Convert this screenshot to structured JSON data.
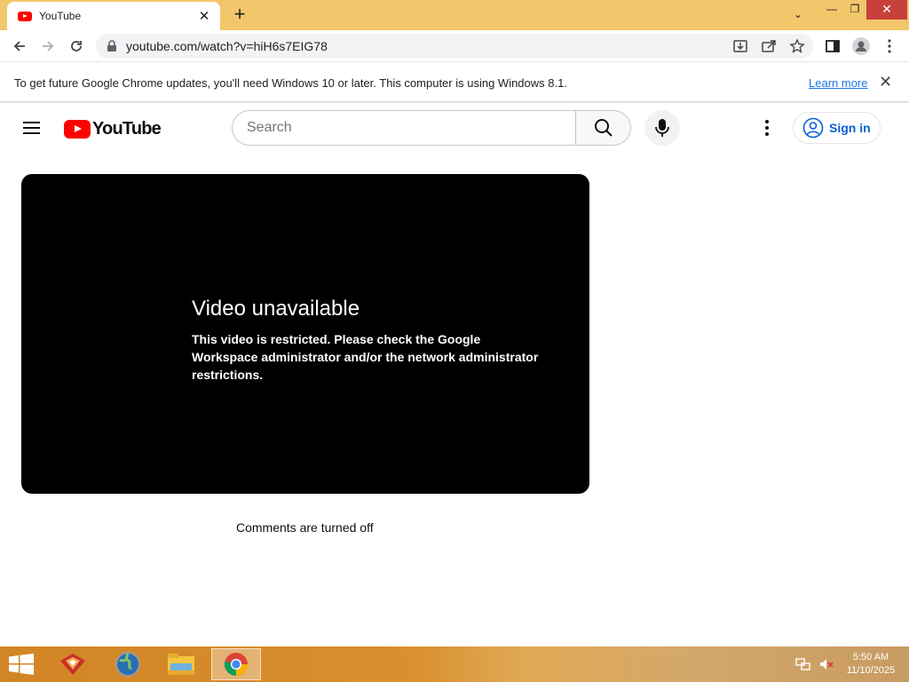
{
  "browser": {
    "tab_title": "YouTube",
    "url": "youtube.com/watch?v=hiH6s7EIG78",
    "tab_close_glyph": "✕",
    "newtab_glyph": "+",
    "window_controls": {
      "minimize": "—",
      "maximize": "❐",
      "close": "✕",
      "tab_search": "⌄"
    }
  },
  "infobar": {
    "message": "To get future Google Chrome updates, you'll need Windows 10 or later. This computer is using Windows 8.1.",
    "link": "Learn more",
    "close_glyph": "✕"
  },
  "youtube": {
    "logo_text": "YouTube",
    "search_placeholder": "Search",
    "sign_in": "Sign in",
    "player": {
      "error_title": "Video unavailable",
      "error_message": "This video is restricted. Please check the Google Workspace administrator and/or the network administrator restrictions."
    },
    "comments_status": "Comments are turned off"
  },
  "taskbar": {
    "time": "5:50 AM",
    "date": "11/10/2025",
    "apps": [
      "app-icon",
      "globe-icon",
      "file-explorer-icon",
      "chrome-icon"
    ]
  },
  "colors": {
    "accent_blue": "#065fd4",
    "youtube_red": "#ff0000",
    "tabstrip": "#f2c66a",
    "player_bg": "#000000"
  }
}
